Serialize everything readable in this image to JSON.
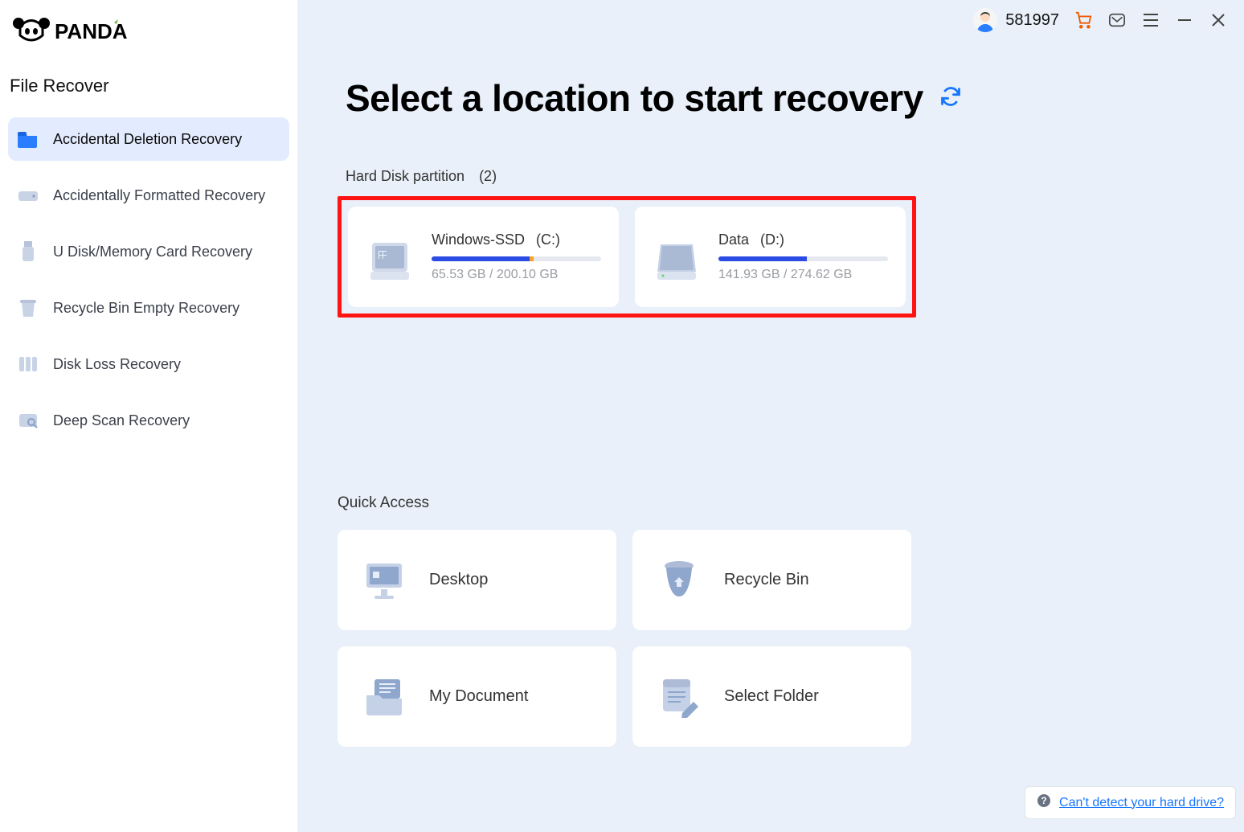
{
  "brand": "PANDA",
  "sidebar": {
    "section_title": "File Recover",
    "items": [
      {
        "label": "Accidental Deletion Recovery",
        "active": true
      },
      {
        "label": "Accidentally Formatted Recovery",
        "active": false
      },
      {
        "label": "U Disk/Memory Card Recovery",
        "active": false
      },
      {
        "label": "Recycle Bin Empty Recovery",
        "active": false
      },
      {
        "label": "Disk Loss Recovery",
        "active": false
      },
      {
        "label": "Deep Scan Recovery",
        "active": false
      }
    ]
  },
  "topbar": {
    "user_id": "581997"
  },
  "page": {
    "title": "Select a location to start recovery"
  },
  "partitions": {
    "title": "Hard Disk partition",
    "count": "(2)",
    "items": [
      {
        "name": "Windows-SSD",
        "letter": "(C:)",
        "used": "65.53 GB",
        "total": "200.10 GB",
        "percent": 60,
        "orange_start": 58,
        "orange_end": 60
      },
      {
        "name": "Data",
        "letter": "(D:)",
        "used": "141.93 GB",
        "total": "274.62 GB",
        "percent": 52,
        "orange_start": 0,
        "orange_end": 0
      }
    ]
  },
  "quick": {
    "title": "Quick Access",
    "items": [
      {
        "label": "Desktop"
      },
      {
        "label": "Recycle Bin"
      },
      {
        "label": "My Document"
      },
      {
        "label": "Select Folder"
      }
    ]
  },
  "help": {
    "text": "Can't detect your hard drive?"
  }
}
